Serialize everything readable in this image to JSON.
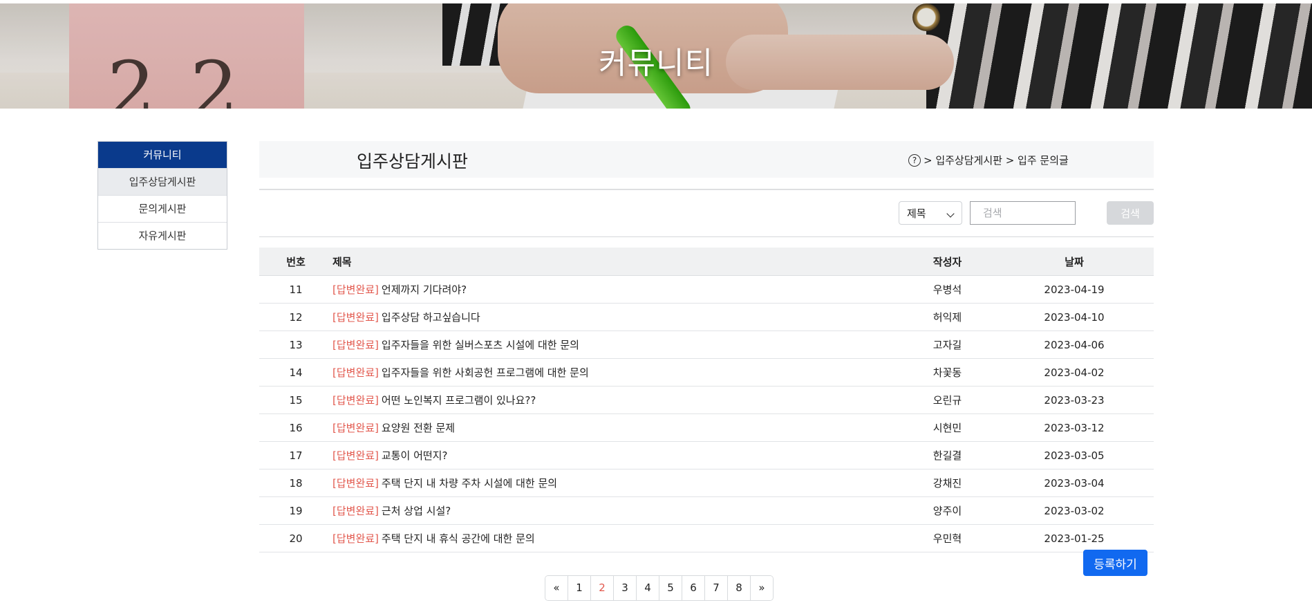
{
  "banner": {
    "title": "커뮤니티"
  },
  "sidebar": {
    "header": "커뮤니티",
    "items": [
      {
        "label": "입주상담게시판",
        "active": true
      },
      {
        "label": "문의게시판",
        "active": false
      },
      {
        "label": "자유게시판",
        "active": false
      }
    ]
  },
  "page": {
    "title": "입주상담게시판",
    "breadcrumb": "> 입주상담게시판 > 입주 문의글"
  },
  "search": {
    "filter_value": "제목",
    "placeholder": "검색",
    "button_label": "검색"
  },
  "table": {
    "headers": {
      "no": "번호",
      "title": "제목",
      "writer": "작성자",
      "date": "날짜"
    },
    "rows": [
      {
        "no": "11",
        "tag": "[답변완료]",
        "title": "언제까지 기다려야?",
        "writer": "우병석",
        "date": "2023-04-19"
      },
      {
        "no": "12",
        "tag": "[답변완료]",
        "title": "입주상담 하고싶습니다",
        "writer": "허익제",
        "date": "2023-04-10"
      },
      {
        "no": "13",
        "tag": "[답변완료]",
        "title": "입주자들을 위한 실버스포츠 시설에 대한 문의",
        "writer": "고자길",
        "date": "2023-04-06"
      },
      {
        "no": "14",
        "tag": "[답변완료]",
        "title": "입주자들을 위한 사회공헌 프로그램에 대한 문의",
        "writer": "차꽃동",
        "date": "2023-04-02"
      },
      {
        "no": "15",
        "tag": "[답변완료]",
        "title": "어떤 노인복지 프로그램이 있나요??",
        "writer": "오린규",
        "date": "2023-03-23"
      },
      {
        "no": "16",
        "tag": "[답변완료]",
        "title": "요양원 전환 문제",
        "writer": "시현민",
        "date": "2023-03-12"
      },
      {
        "no": "17",
        "tag": "[답변완료]",
        "title": "교통이 어떤지?",
        "writer": "한길결",
        "date": "2023-03-05"
      },
      {
        "no": "18",
        "tag": "[답변완료]",
        "title": "주택 단지 내 차량 주차 시설에 대한 문의",
        "writer": "강채진",
        "date": "2023-03-04"
      },
      {
        "no": "19",
        "tag": "[답변완료]",
        "title": "근처 상업 시설?",
        "writer": "양주이",
        "date": "2023-03-02"
      },
      {
        "no": "20",
        "tag": "[답변완료]",
        "title": "주택 단지 내 휴식 공간에 대한 문의",
        "writer": "우민혁",
        "date": "2023-01-25"
      }
    ]
  },
  "actions": {
    "register_label": "등록하기"
  },
  "pagination": {
    "prev": "«",
    "pages": [
      "1",
      "2",
      "3",
      "4",
      "5",
      "6",
      "7",
      "8"
    ],
    "current": "2",
    "next": "»"
  },
  "colors": {
    "sidebar_header_bg": "#0a3a8c",
    "status_tag": "#e2574c",
    "register_button": "#1169f0",
    "search_button": "#d6d8db"
  }
}
